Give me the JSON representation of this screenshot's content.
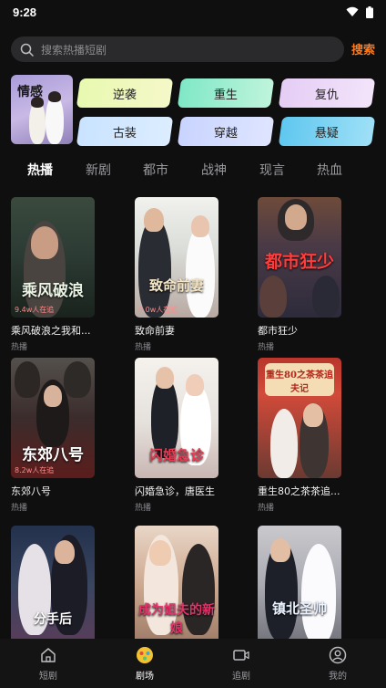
{
  "status": {
    "time": "9:28"
  },
  "search": {
    "placeholder": "搜索热播短剧",
    "button_label": "搜索"
  },
  "genres": {
    "featured": "情感",
    "chips": [
      "逆袭",
      "重生",
      "复仇",
      "古装",
      "穿越",
      "悬疑"
    ]
  },
  "tabs": [
    "热播",
    "新剧",
    "都市",
    "战神",
    "现言",
    "热血"
  ],
  "active_tab": "热播",
  "dramas": [
    {
      "title": "乘风破浪之我和...",
      "sub": "热播",
      "poster_text": "乘风破浪",
      "views": "9.4w人在追"
    },
    {
      "title": "致命前妻",
      "sub": "热播",
      "poster_text": "致命前妻",
      "views": "9.0w人在追"
    },
    {
      "title": "都市狂少",
      "sub": "热播",
      "poster_text": "都市狂少",
      "views": ""
    },
    {
      "title": "东郊八号",
      "sub": "热播",
      "poster_text": "东郊八号",
      "views": "8.2w人在追"
    },
    {
      "title": "闪婚急诊，唐医生",
      "sub": "热播",
      "poster_text": "闪婚急诊",
      "views": ""
    },
    {
      "title": "重生80之茶茶追...",
      "sub": "热播",
      "poster_text": "重生80之茶茶追夫记",
      "views": ""
    },
    {
      "title": "",
      "sub": "",
      "poster_text": "分手后",
      "views": ""
    },
    {
      "title": "",
      "sub": "",
      "poster_text": "成为姐夫的新娘",
      "views": ""
    },
    {
      "title": "",
      "sub": "",
      "poster_text": "镇北圣帅",
      "views": ""
    }
  ],
  "nav": [
    {
      "label": "短剧",
      "icon": "home-icon"
    },
    {
      "label": "剧场",
      "icon": "theater-icon"
    },
    {
      "label": "追剧",
      "icon": "video-icon"
    },
    {
      "label": "我的",
      "icon": "profile-icon"
    }
  ],
  "active_nav": "剧场",
  "colors": {
    "accent": "#ff7a1a",
    "background": "#0f0f10"
  }
}
